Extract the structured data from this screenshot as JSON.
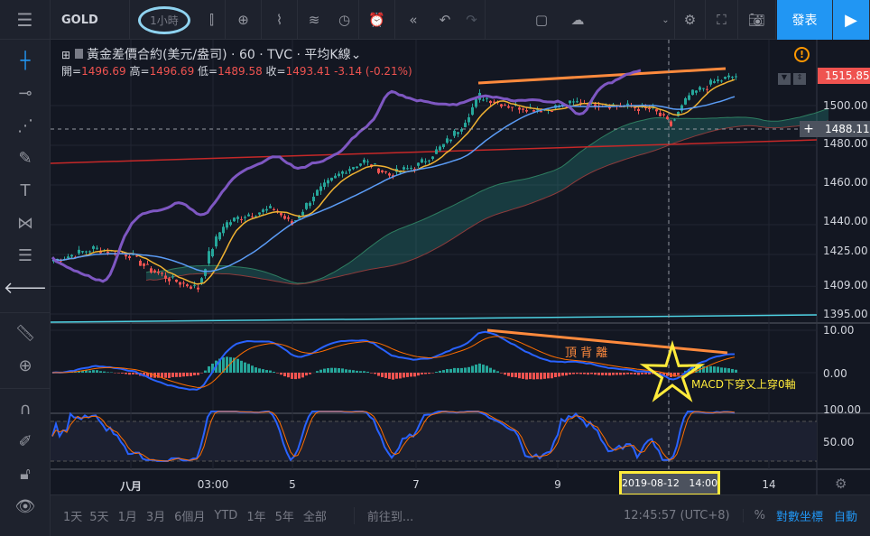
{
  "toolbar": {
    "symbol": "GOLD",
    "interval": "1小時",
    "publish": "發表"
  },
  "legend": {
    "title": "黃金差價合約(美元/盎司)",
    "interval": "60",
    "source": "TVC",
    "chart_type": "平均K線",
    "open_label": "開=",
    "open": "1496.69",
    "high_label": "高=",
    "high": "1496.69",
    "low_label": "低=",
    "low": "1489.58",
    "close_label": "收=",
    "close": "1493.41",
    "change": "-3.14 (-0.21%)"
  },
  "price_axis": {
    "labels": [
      "1500.00",
      "1480.00",
      "1460.00",
      "1440.00",
      "1425.00",
      "1409.00",
      "1395.00"
    ],
    "last_price": "1515.85",
    "crosshair_price": "1488.11"
  },
  "macd_axis": [
    "10.00",
    "0.00"
  ],
  "stoch_axis": [
    "100.00",
    "50.00"
  ],
  "time_axis": {
    "labels": [
      "八月",
      "03:00",
      "5",
      "7",
      "9",
      "14"
    ],
    "crosshair": "2019-08-12   14:00"
  },
  "annotations": {
    "divergence": "頂 背 離",
    "macd_note": "MACD下穿又上穿0軸"
  },
  "bottom": {
    "ranges": [
      "1天",
      "5天",
      "1月",
      "3月",
      "6個月",
      "YTD",
      "1年",
      "5年",
      "全部"
    ],
    "goto": "前往到...",
    "clock": "12:45:57 (UTC+8)",
    "percent": "%",
    "log": "對數坐標",
    "auto": "自動"
  },
  "colors": {
    "up": "#26a69a",
    "down": "#ef5350",
    "accent": "#2196f3",
    "highlight": "#ffeb3b",
    "trend": "#ff8a3d"
  },
  "chart_data": {
    "type": "candlestick",
    "ylim": [
      1390,
      1522
    ],
    "bars": 190,
    "close_path": [
      [
        0,
        1422
      ],
      [
        11,
        1428
      ],
      [
        21,
        1425
      ],
      [
        26,
        1418
      ],
      [
        33,
        1412
      ],
      [
        40,
        1408
      ],
      [
        43,
        1425
      ],
      [
        47,
        1440
      ],
      [
        53,
        1445
      ],
      [
        61,
        1448
      ],
      [
        66,
        1440
      ],
      [
        72,
        1455
      ],
      [
        81,
        1468
      ],
      [
        86,
        1472
      ],
      [
        93,
        1465
      ],
      [
        101,
        1470
      ],
      [
        108,
        1480
      ],
      [
        113,
        1490
      ],
      [
        118,
        1505
      ],
      [
        126,
        1500
      ],
      [
        136,
        1498
      ],
      [
        146,
        1502
      ],
      [
        156,
        1500
      ],
      [
        166,
        1498
      ],
      [
        171,
        1490
      ],
      [
        176,
        1505
      ],
      [
        183,
        1512
      ],
      [
        189,
        1515
      ]
    ]
  }
}
